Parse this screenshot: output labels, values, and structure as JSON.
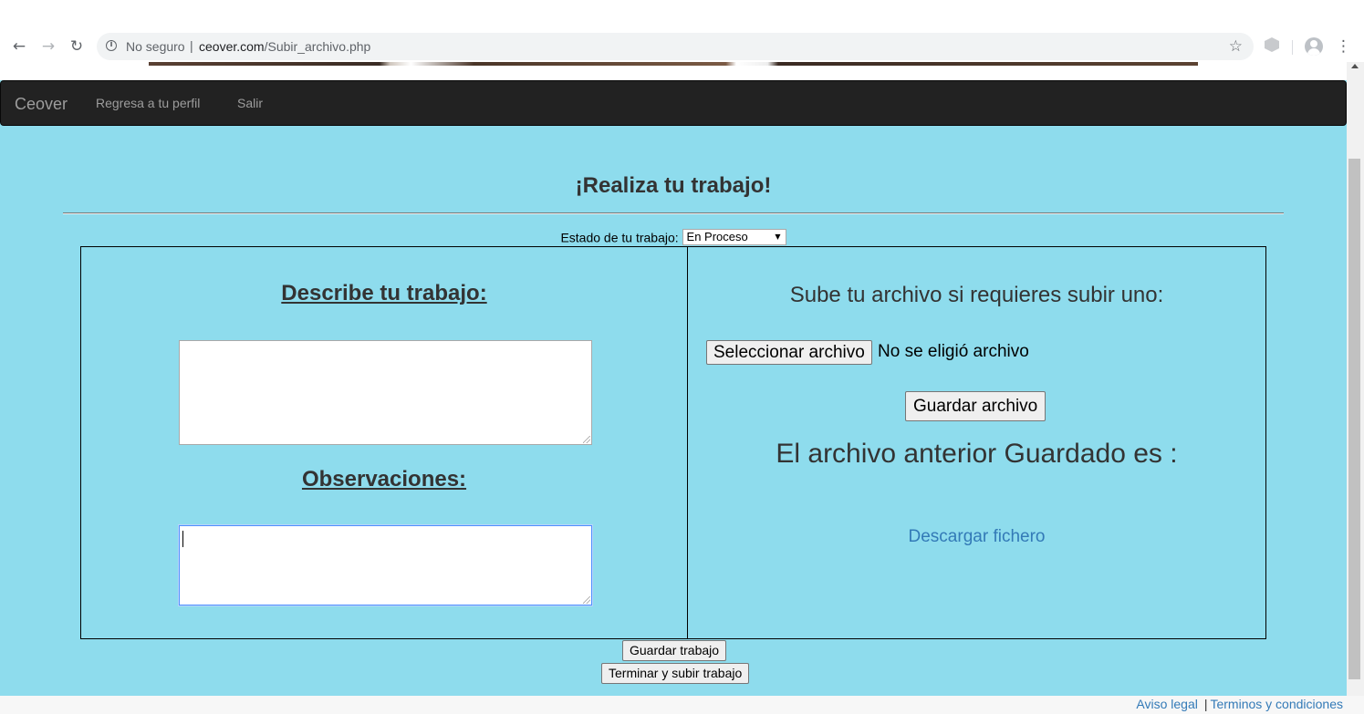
{
  "browser": {
    "back_icon": "arrow-back-icon",
    "forward_icon": "arrow-forward-icon",
    "reload_icon": "reload-icon",
    "security_label": "No seguro",
    "url_host": "ceover.com",
    "url_path": "/Subir_archivo.php",
    "bookmark_icon": "star-icon",
    "menu_icon": "more-vert-icon"
  },
  "navbar": {
    "brand": "Ceover",
    "links": [
      "Regresa a tu perfil",
      "Salir"
    ]
  },
  "page": {
    "heading": "¡Realiza tu trabajo!",
    "status_label": "Estado de tu trabajo:",
    "status_selected": "En Proceso"
  },
  "left_panel": {
    "describe_title": "Describe tu trabajo:",
    "describe_value": "",
    "observations_title": "Observaciones:",
    "observations_value": ""
  },
  "right_panel": {
    "upload_title": "Sube tu archivo si requieres subir uno:",
    "file_button": "Seleccionar archivo",
    "file_status": "No se eligió archivo",
    "save_file_button": "Guardar archivo",
    "previous_file_label": "El archivo anterior Guardado es :",
    "download_link": "Descargar fichero"
  },
  "actions": {
    "save_work": "Guardar trabajo",
    "finish_upload": "Terminar y subir trabajo"
  },
  "footer": {
    "legal": "Aviso legal",
    "separator": "|",
    "terms": "Terminos y condiciones"
  },
  "colors": {
    "page_background": "#8edced",
    "navbar_background": "#222222",
    "link": "#337ab7"
  }
}
